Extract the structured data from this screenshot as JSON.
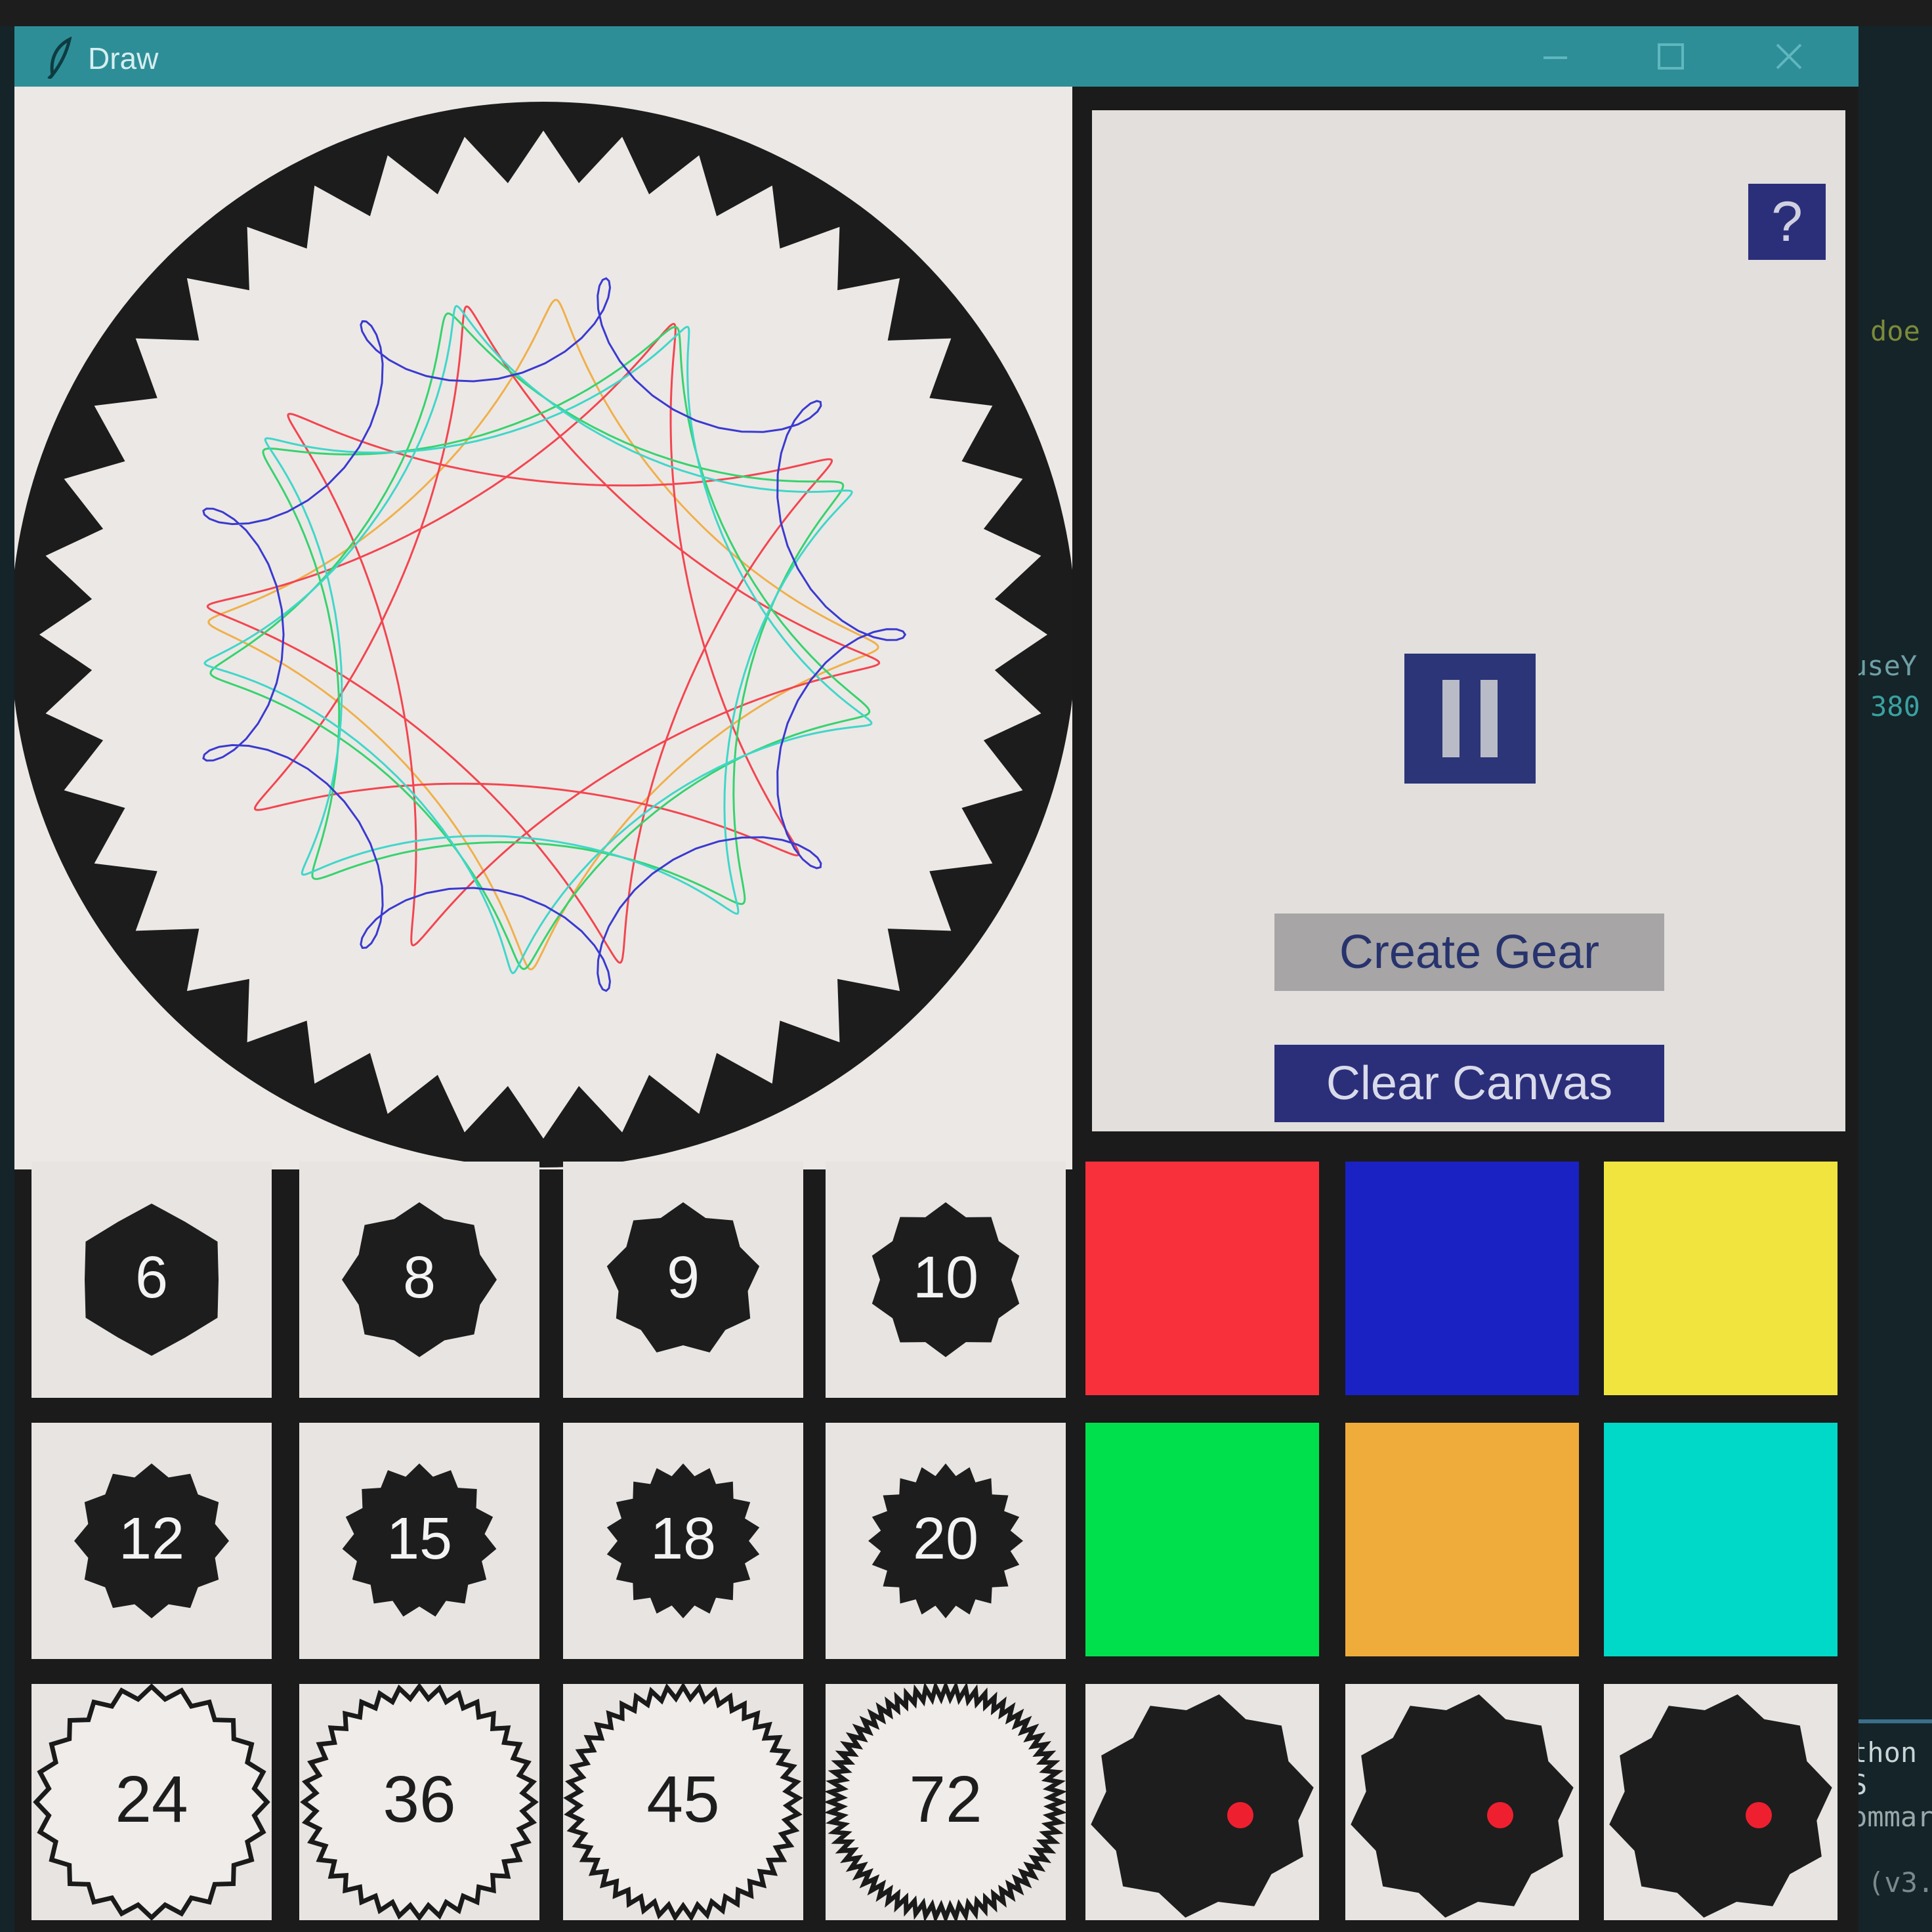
{
  "window": {
    "title": "Draw"
  },
  "background_ide": {
    "snippets": [
      "doe",
      "useY",
      "380",
      "thon S",
      "ommar",
      "(v3."
    ]
  },
  "control_panel": {
    "help_label": "?",
    "pause_icon": "pause-icon",
    "create_gear_label": "Create Gear",
    "clear_canvas_label": "Clear Canvas"
  },
  "gear_sizes": {
    "row1": [
      "6",
      "8",
      "9",
      "10"
    ],
    "row2": [
      "12",
      "15",
      "18",
      "20"
    ],
    "row3": [
      "24",
      "36",
      "45",
      "72"
    ]
  },
  "colors": {
    "palette": [
      "#f8303c",
      "#1a22c4",
      "#f2e43e",
      "#00e04c",
      "#f0ac3a",
      "#00d8c8"
    ],
    "accent": "#2b2f7a",
    "pen_dot": "#ee2030"
  },
  "pen_gears": {
    "items": [
      "pen-gear-icon",
      "pen-gear-icon",
      "pen-gear-icon"
    ]
  }
}
